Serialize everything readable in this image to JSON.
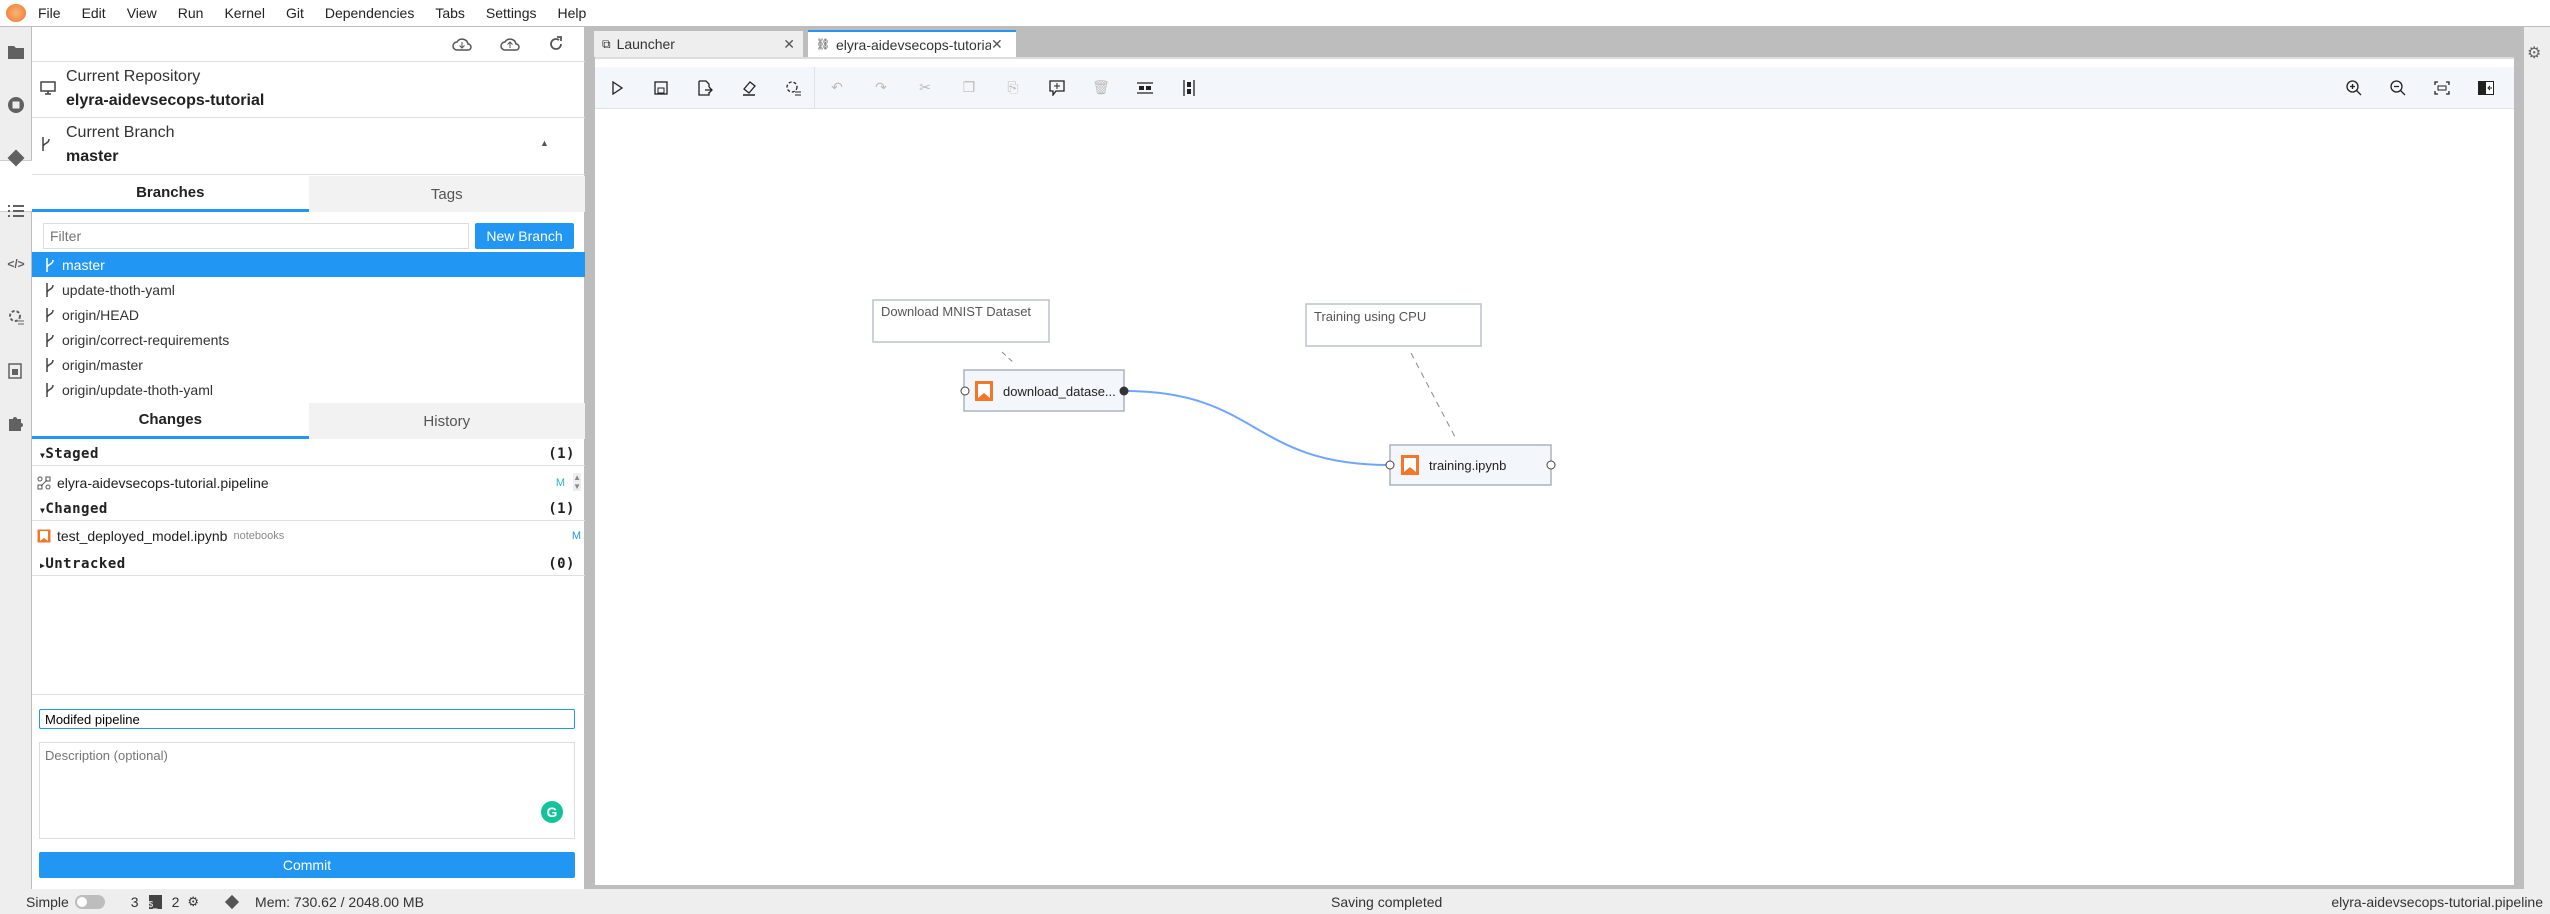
{
  "menu": [
    "File",
    "Edit",
    "View",
    "Run",
    "Kernel",
    "Git",
    "Dependencies",
    "Tabs",
    "Settings",
    "Help"
  ],
  "git": {
    "repo_label": "Current Repository",
    "repo_name": "elyra-aidevsecops-tutorial",
    "branch_label": "Current Branch",
    "branch_name": "master",
    "branch_tabs": [
      "Branches",
      "Tags"
    ],
    "filter_placeholder": "Filter",
    "new_branch": "New Branch",
    "branches": [
      "master",
      "update-thoth-yaml",
      "origin/HEAD",
      "origin/correct-requirements",
      "origin/master",
      "origin/update-thoth-yaml"
    ],
    "change_tabs": [
      "Changes",
      "History"
    ],
    "staged": {
      "label": "Staged",
      "count": "(1)",
      "files": [
        {
          "name": "elyra-aidevsecops-tutorial.pipeline",
          "status": "M"
        }
      ]
    },
    "changed": {
      "label": "Changed",
      "count": "(1)",
      "files": [
        {
          "name": "test_deployed_model.ipynb",
          "dir": "notebooks",
          "status": "M"
        }
      ]
    },
    "untracked": {
      "label": "Untracked",
      "count": "(0)"
    },
    "summary_value": "Modifed pipeline",
    "description_placeholder": "Description (optional)",
    "commit": "Commit"
  },
  "tabs": [
    {
      "label": "Launcher"
    },
    {
      "label": "elyra-aidevsecops-tutorial.pipeline",
      "active": true
    }
  ],
  "pipeline": {
    "comments": [
      "Download MNIST Dataset",
      "Training using CPU"
    ],
    "nodes": [
      "download_datase...",
      "training.ipynb"
    ]
  },
  "status": {
    "mode": "Simple",
    "terminals": "3",
    "kernels": "2",
    "memory": "Mem: 730.62 / 2048.00 MB",
    "message": "Saving completed",
    "file": "elyra-aidevsecops-tutorial.pipeline"
  },
  "colors": {
    "accent": "#2196f3",
    "notebook": "#f37726",
    "link": "#6ea6ff"
  }
}
